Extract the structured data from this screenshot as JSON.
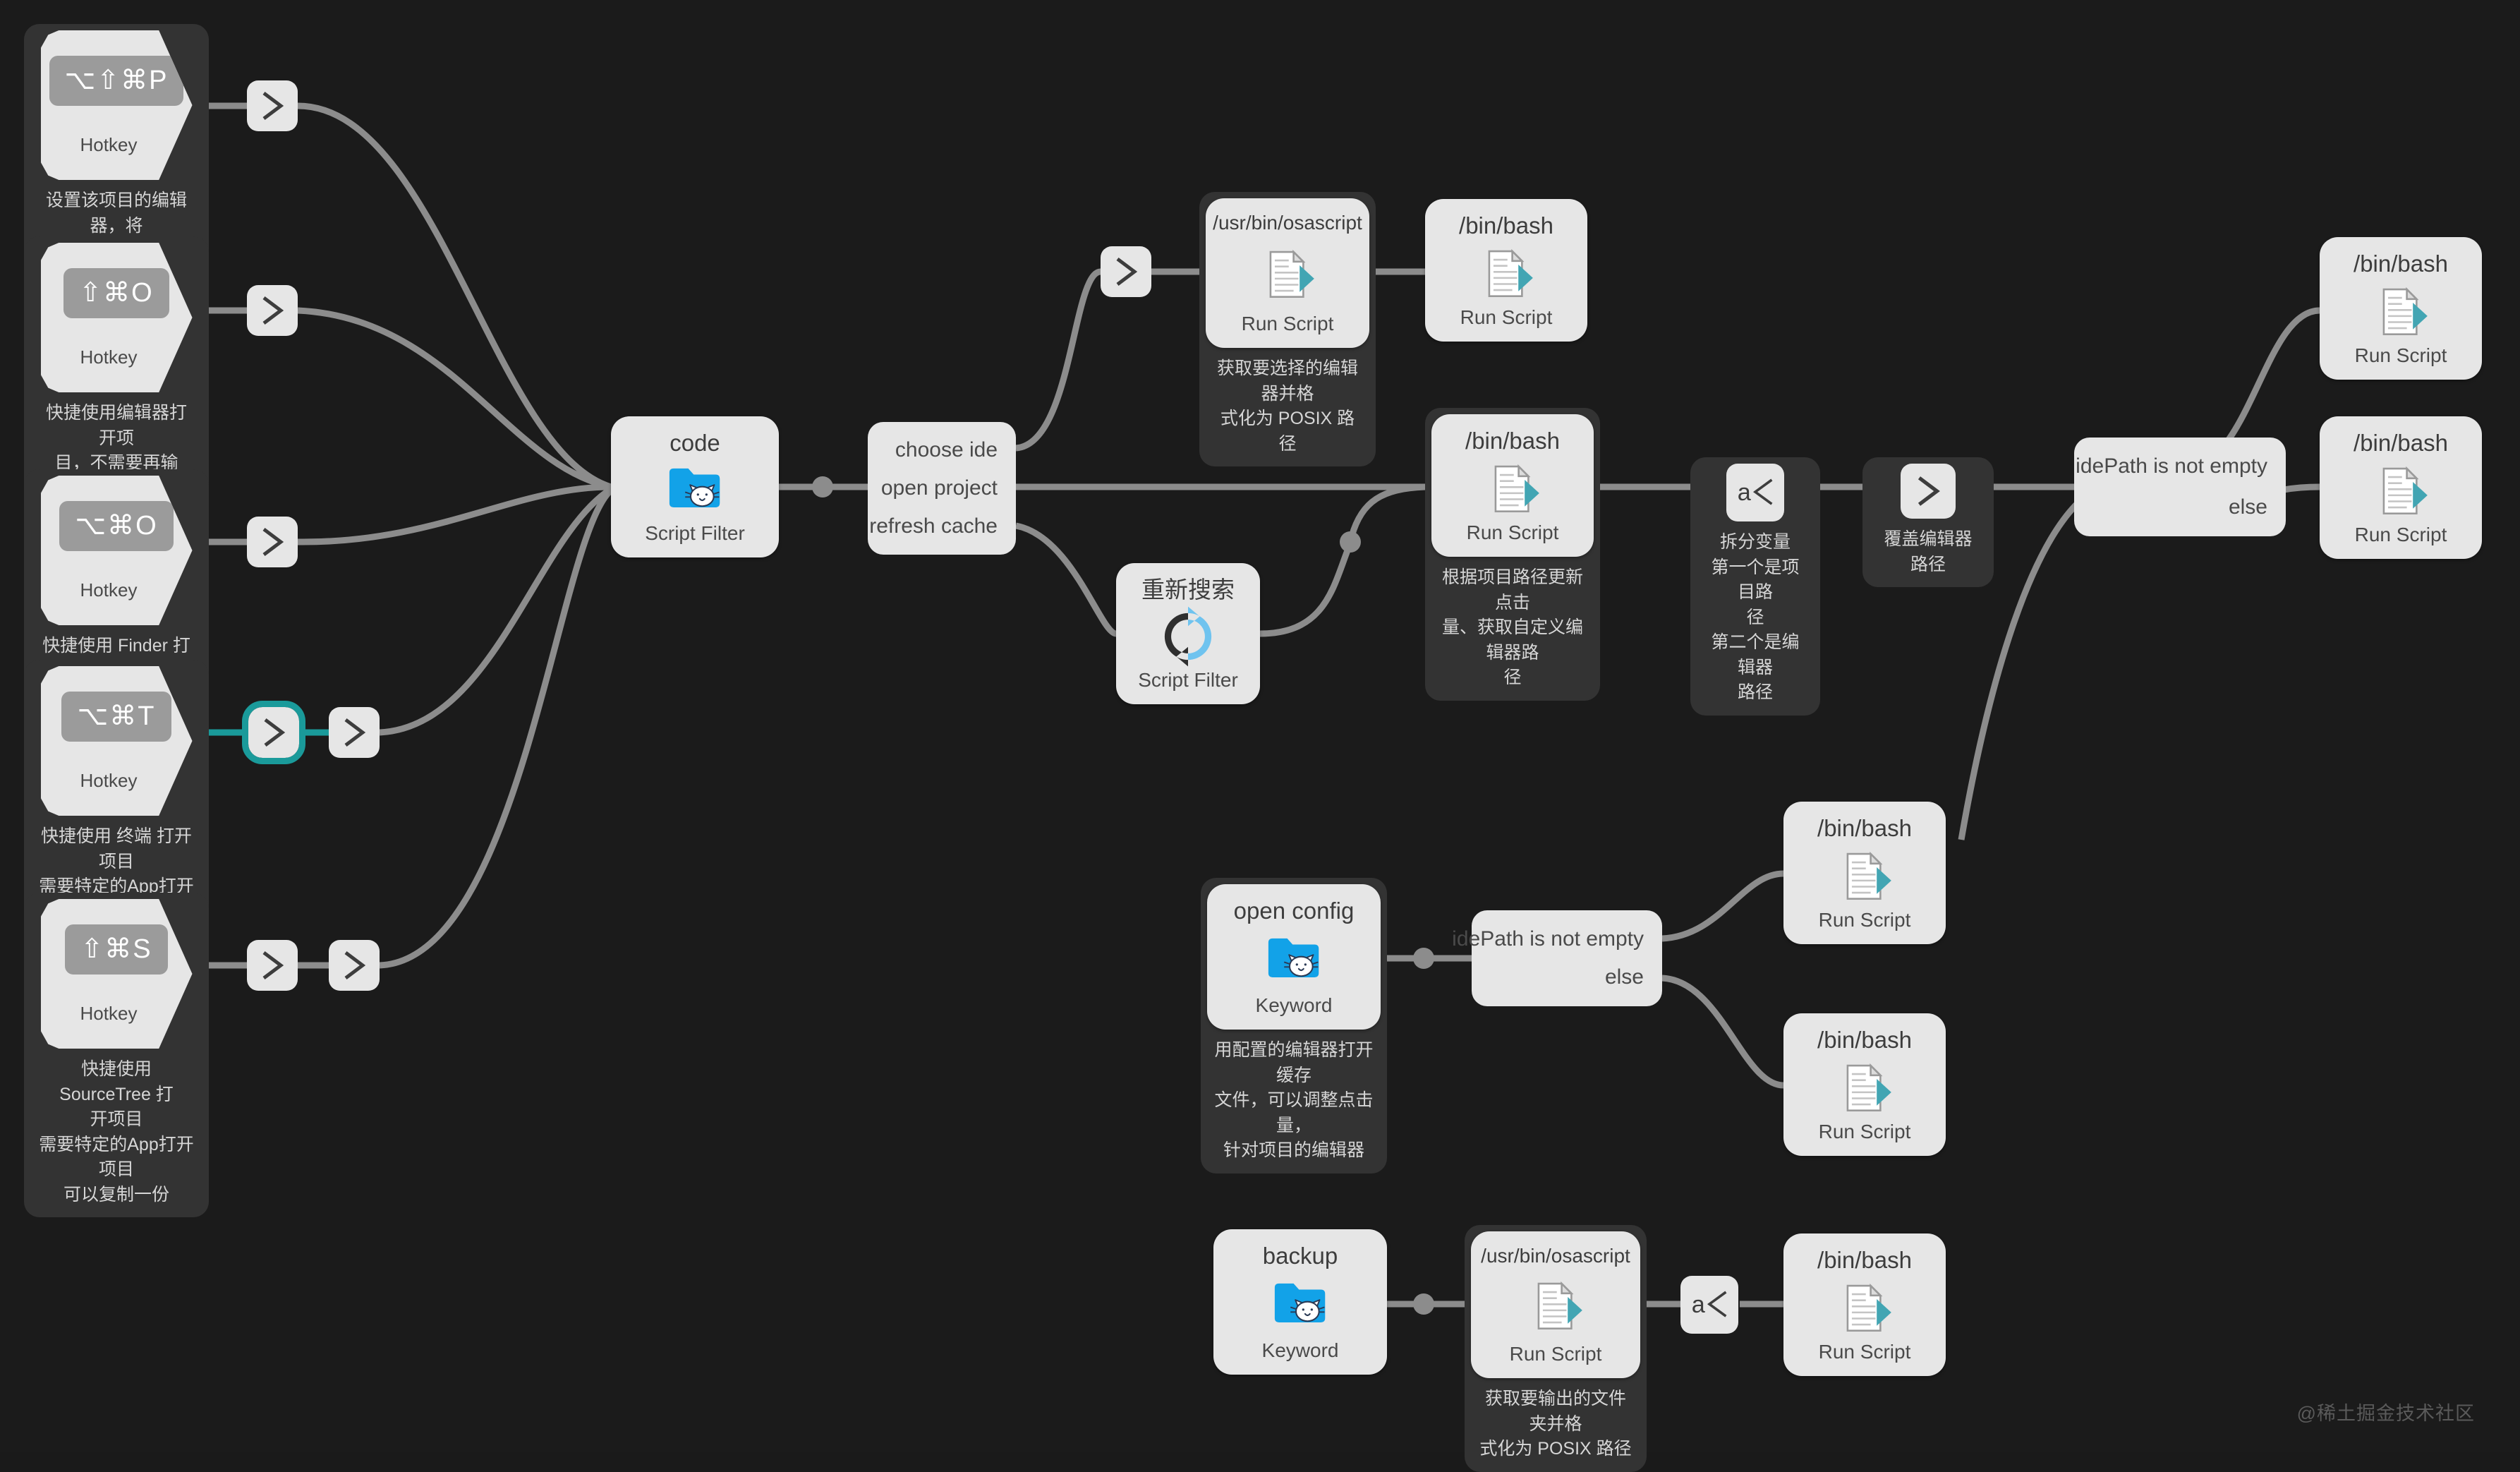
{
  "canvas": {
    "background": "#1b1b1b",
    "node_bg": "#e6e6e6",
    "comment_bg": "#333333",
    "wire_color": "#8c8c8c",
    "accent_selected": "#1a9a9a",
    "folder_blue": "#12a2e8",
    "doc_teal": "#42a5b3",
    "watermark": "@稀土掘金技术社区"
  },
  "labels": {
    "hotkey": "Hotkey",
    "script_filter": "Script Filter",
    "run_script": "Run Script",
    "keyword": "Keyword"
  },
  "hotkeys": [
    {
      "keys": "⌥⇧⌘P",
      "type": "Hotkey",
      "comment": "设置该项目的编辑器，将\n打开 Finder 选择 App"
    },
    {
      "keys": "⇧⌘O",
      "type": "Hotkey",
      "comment": "快捷使用编辑器打开项\n目，不需要再输 code 前\n缀"
    },
    {
      "keys": "⌥⌘O",
      "type": "Hotkey",
      "comment": "快捷使用 Finder 打开项目"
    },
    {
      "keys": "⌥⌘T",
      "type": "Hotkey",
      "comment": "快捷使用 终端 打开项目\n需要特定的App打开项目\n可以复制一份"
    },
    {
      "keys": "⇧⌘S",
      "type": "Hotkey",
      "comment": "快捷使用 SourceTree 打\n开项目\n需要特定的App打开项目\n可以复制一份"
    }
  ],
  "nodes": {
    "code_filter": {
      "title": "code",
      "subtitle": "Script Filter",
      "icon": "folder-cat-icon"
    },
    "ide_list": {
      "rows": [
        "choose ide",
        "open project",
        "refresh cache"
      ]
    },
    "osascript_top": {
      "title": "/usr/bin/osascript",
      "subtitle": "Run Script",
      "icon": "script-doc-icon",
      "comment": "获取要选择的编辑器并格\n式化为 POSIX 路径"
    },
    "bash_top": {
      "title": "/bin/bash",
      "subtitle": "Run Script",
      "icon": "script-doc-icon"
    },
    "bash_center": {
      "title": "/bin/bash",
      "subtitle": "Run Script",
      "icon": "script-doc-icon",
      "comment": "根据项目路径更新点击\n量、获取自定义编辑器路\n径"
    },
    "refresh_filter": {
      "title": "重新搜索",
      "subtitle": "Script Filter",
      "icon": "refresh-icon"
    },
    "split_vars": {
      "icon": "split-args-icon",
      "comment": "拆分变量\n第一个是项目路\n径\n第二个是编辑器\n路径"
    },
    "override_ide": {
      "icon": "chevron-right-icon",
      "comment": "覆盖编辑器路径"
    },
    "cond_main": {
      "rows": [
        "idePath is not empty",
        "else"
      ]
    },
    "bash_right_top": {
      "title": "/bin/bash",
      "subtitle": "Run Script",
      "icon": "script-doc-icon"
    },
    "bash_right_bottom": {
      "title": "/bin/bash",
      "subtitle": "Run Script",
      "icon": "script-doc-icon"
    },
    "open_config": {
      "title": "open config",
      "subtitle": "Keyword",
      "icon": "folder-cat-icon",
      "comment": "用配置的编辑器打开缓存\n文件，可以调整点击量，\n针对项目的编辑器"
    },
    "cond_config": {
      "rows": [
        "idePath is not empty",
        "else"
      ]
    },
    "bash_cfg_top": {
      "title": "/bin/bash",
      "subtitle": "Run Script",
      "icon": "script-doc-icon"
    },
    "bash_cfg_bottom": {
      "title": "/bin/bash",
      "subtitle": "Run Script",
      "icon": "script-doc-icon"
    },
    "backup": {
      "title": "backup",
      "subtitle": "Keyword",
      "icon": "folder-cat-icon"
    },
    "osascript_backup": {
      "title": "/usr/bin/osascript",
      "subtitle": "Run Script",
      "icon": "script-doc-icon",
      "comment": "获取要输出的文件夹并格\n式化为 POSIX 路径"
    },
    "split_backup": {
      "icon": "split-args-icon"
    },
    "bash_backup": {
      "title": "/bin/bash",
      "subtitle": "Run Script",
      "icon": "script-doc-icon"
    }
  }
}
